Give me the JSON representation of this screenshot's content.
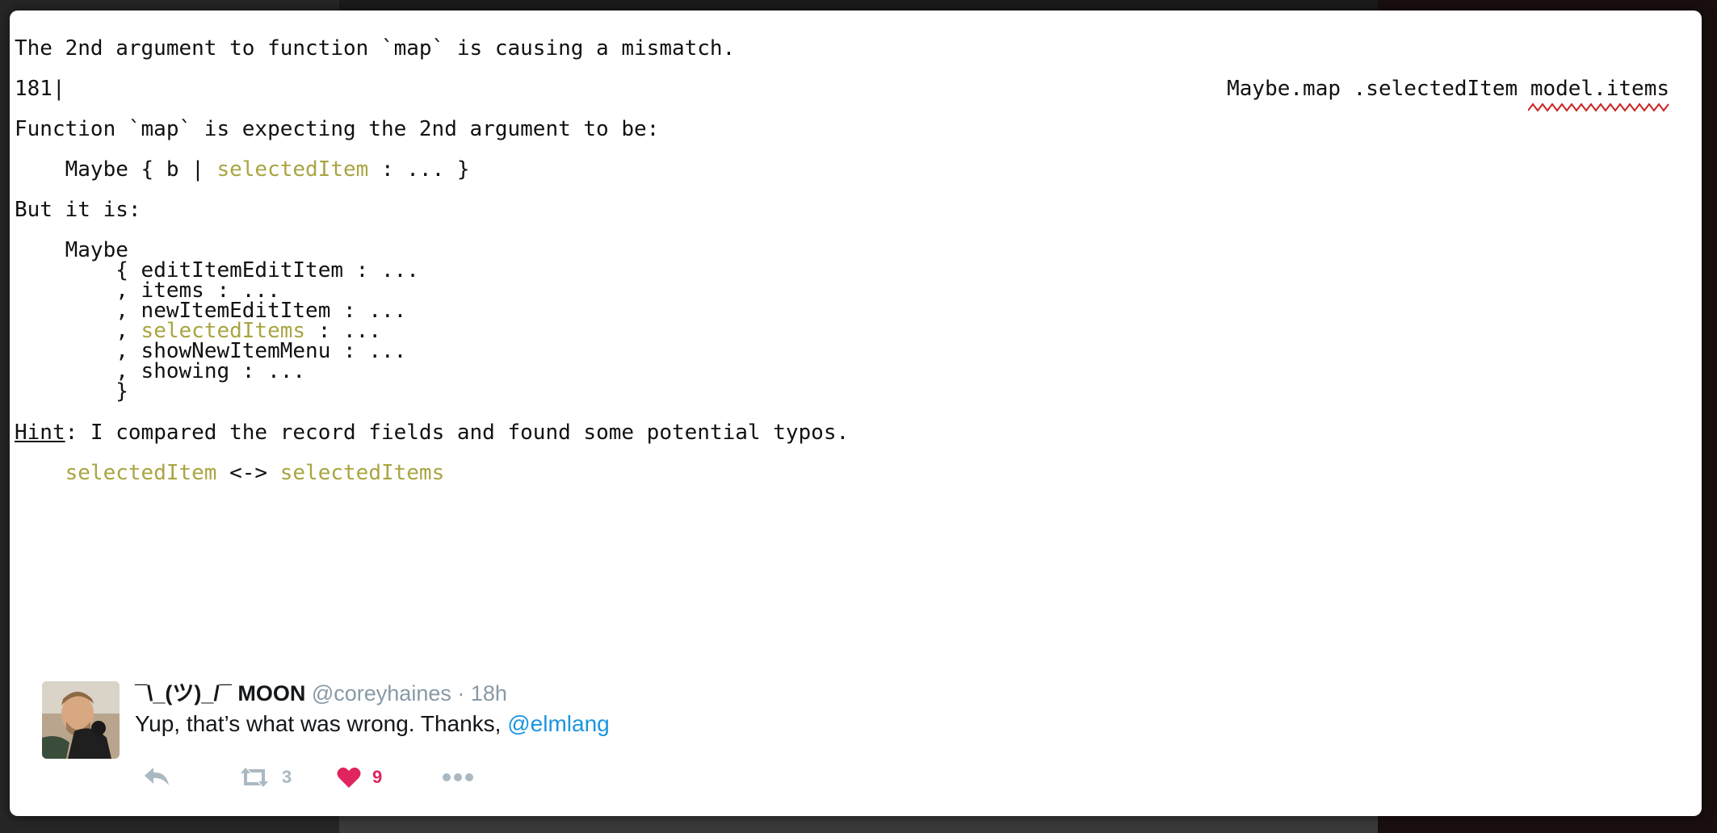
{
  "error": {
    "line1": "The 2nd argument to function `map` is causing a mismatch.",
    "line_number": "181|",
    "source_prefix": "Maybe.map .selectedItem ",
    "source_arg": "model.items",
    "expect_label": "Function `map` is expecting the 2nd argument to be:",
    "expected_prefix": "    Maybe { b | ",
    "expected_field": "selectedItem",
    "expected_suffix": " : ... }",
    "but_label": "But it is:",
    "actual_type": "    Maybe",
    "actual_fields": [
      {
        "prefix": "        { ",
        "name": "editItemEditItem",
        "suffix": " : ...",
        "highlight": false
      },
      {
        "prefix": "        , ",
        "name": "items",
        "suffix": " : ...",
        "highlight": false
      },
      {
        "prefix": "        , ",
        "name": "newItemEditItem",
        "suffix": " : ...",
        "highlight": false
      },
      {
        "prefix": "        , ",
        "name": "selectedItems",
        "suffix": " : ...",
        "highlight": true
      },
      {
        "prefix": "        , ",
        "name": "showNewItemMenu",
        "suffix": " : ...",
        "highlight": false
      },
      {
        "prefix": "        , ",
        "name": "showing",
        "suffix": " : ...",
        "highlight": false
      }
    ],
    "actual_close": "        }",
    "hint_word": "Hint",
    "hint_text": ": I compared the record fields and found some potential typos.",
    "typo_left": "selectedItem",
    "typo_arrow": " <-> ",
    "typo_right": "selectedItems"
  },
  "tweet": {
    "display_name": "¯\\_(ツ)_/¯ MOON",
    "handle": "@coreyhaines",
    "separator": "·",
    "time": "18h",
    "text": "Yup, that’s what was wrong. Thanks, ",
    "mention": "@elmlang",
    "retweet_count": "3",
    "like_count": "9"
  },
  "colors": {
    "highlight": "#a9a542",
    "squiggle": "#cc2222",
    "mention": "#1b95e0",
    "like": "#e0245e",
    "muted": "#8899a6"
  },
  "icons": [
    "reply-icon",
    "retweet-icon",
    "heart-icon",
    "more-icon"
  ]
}
